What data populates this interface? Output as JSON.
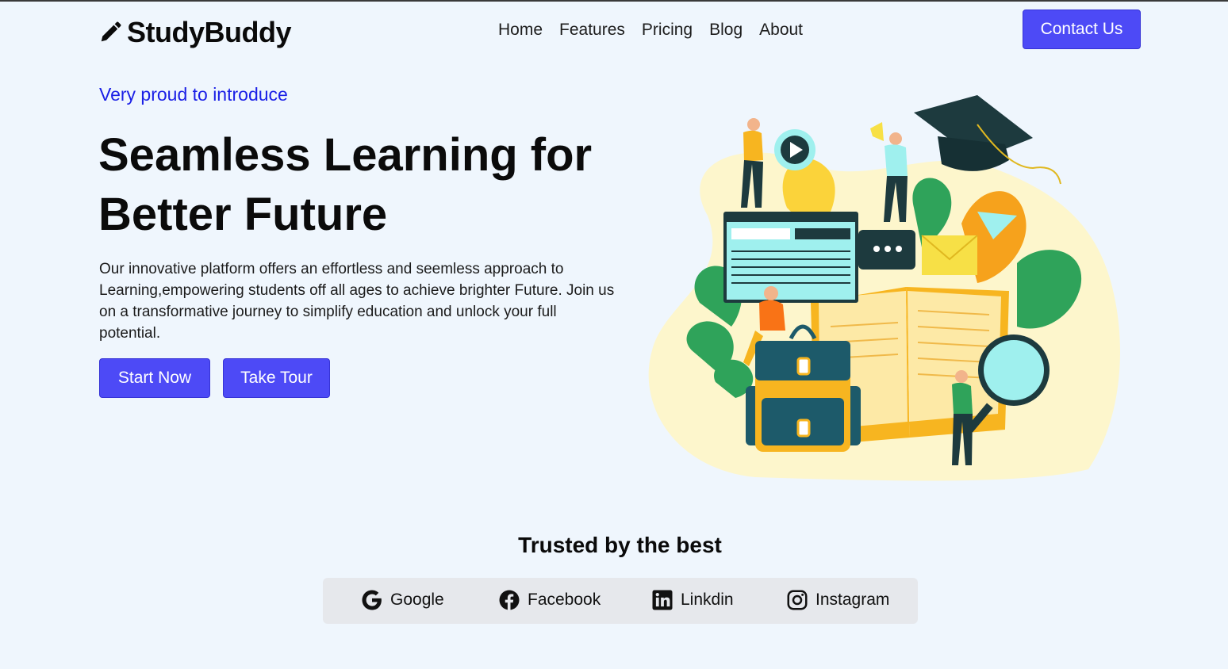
{
  "header": {
    "brand": "StudyBuddy",
    "nav": [
      "Home",
      "Features",
      "Pricing",
      "Blog",
      "About"
    ],
    "contact_label": "Contact Us"
  },
  "hero": {
    "eyebrow": "Very proud to introduce",
    "title_line1": "Seamless Learning for",
    "title_line2": "Better Future",
    "description": "Our innovative platform offers an effortless and seemless approach to Learning,empowering students off all ages to achieve brighter Future. Join us on a transformative journey to simplify education and unlock your full potential.",
    "start_label": "Start Now",
    "tour_label": "Take Tour"
  },
  "trusted": {
    "title": "Trusted by the best",
    "brands": [
      {
        "label": "Google",
        "icon": "google-icon"
      },
      {
        "label": "Facebook",
        "icon": "facebook-icon"
      },
      {
        "label": "Linkdin",
        "icon": "linkedin-icon"
      },
      {
        "label": "Instagram",
        "icon": "instagram-icon"
      }
    ]
  },
  "colors": {
    "accent": "#4d4af6",
    "eyebrow": "#1a1fe6",
    "background": "#eff6fd",
    "bar": "#e6e8ec"
  }
}
